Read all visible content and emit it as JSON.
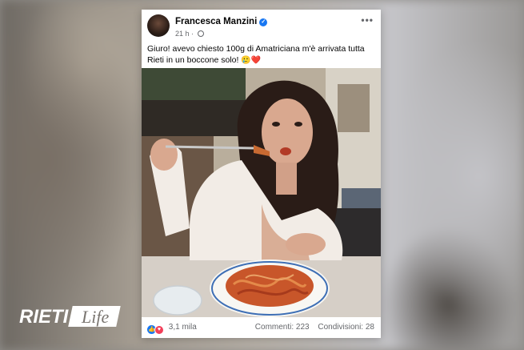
{
  "post": {
    "author": "Francesca Manzini",
    "time": "21 h",
    "dot": "·",
    "caption": "Giuro! avevo chiesto 100g di Amatriciana m'è arrivata tutta Rieti in un boccone solo!",
    "caption_emojis": "🥲❤️",
    "more_glyph": "•••"
  },
  "footer": {
    "reactions_count": "3,1 mila",
    "comments": "Commenti: 223",
    "shares": "Condivisioni: 28"
  },
  "watermark": {
    "text_left": "RIETI",
    "text_right": "Life"
  },
  "colors": {
    "facebook_blue": "#1877f2",
    "love_red": "#f33e58",
    "text_primary": "#050505",
    "text_secondary": "#65676b"
  }
}
